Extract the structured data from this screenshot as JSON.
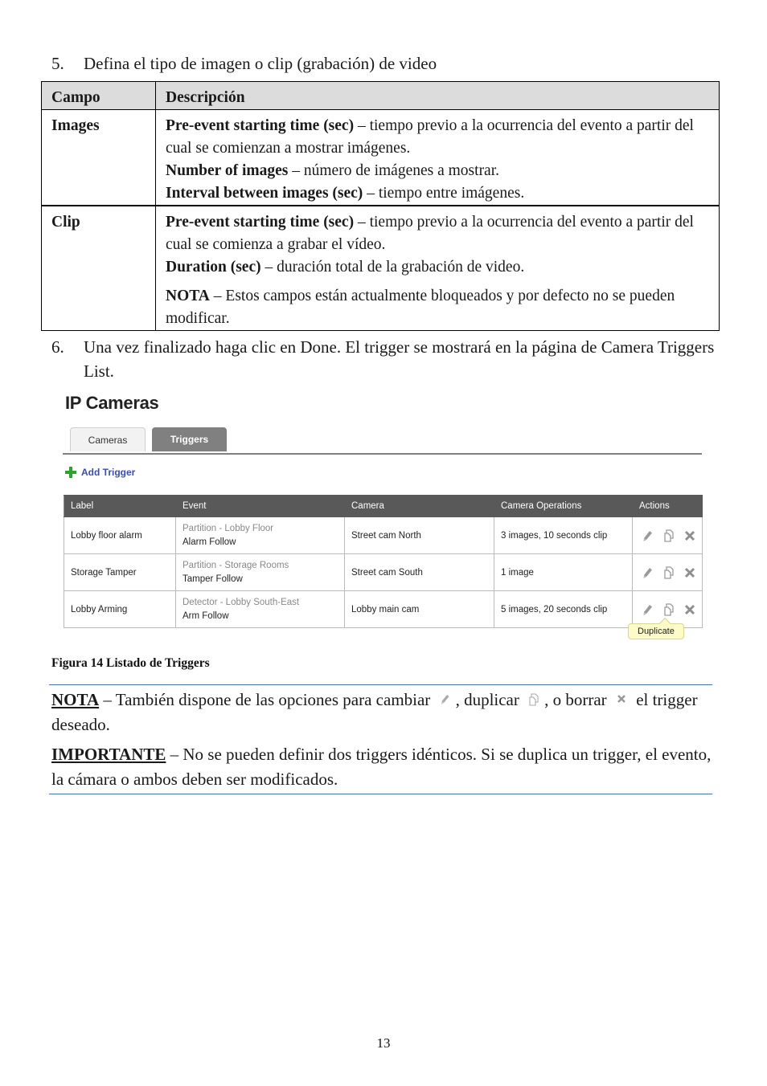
{
  "step5": {
    "number": "5.",
    "text": "Defina el tipo de imagen o clip (grabación) de video"
  },
  "fields_table": {
    "headers": [
      "Campo",
      "Descripción"
    ],
    "rows": [
      {
        "campo": "Images",
        "lines": [
          {
            "term": "Pre-event starting time (sec)",
            "desc": " – tiempo previo a la ocurrencia del evento a partir del cual se comienzan a mostrar imágenes."
          },
          {
            "term": "Number of images",
            "desc": " – número de imágenes a mostrar."
          },
          {
            "term": "Interval between images (sec)",
            "desc": " – tiempo entre imágenes."
          }
        ]
      },
      {
        "campo": "Clip",
        "lines": [
          {
            "term": "Pre-event starting time (sec)",
            "desc": " – tiempo previo a la ocurrencia del evento a partir del cual se comienza a grabar el vídeo."
          },
          {
            "term": "Duration (sec)",
            "desc": " – duración total de la grabación de video."
          },
          {
            "term": "NOTA",
            "desc": " – Estos campos están actualmente bloqueados y por defecto no se pueden modificar."
          }
        ]
      }
    ]
  },
  "step6": {
    "number": "6.",
    "text": "Una vez finalizado haga clic en Done. El trigger se mostrará en la página de Camera Triggers List."
  },
  "screenshot": {
    "title": "IP Cameras",
    "tabs": [
      {
        "label": "Cameras",
        "active": false
      },
      {
        "label": "Triggers",
        "active": true
      }
    ],
    "add_trigger_label": "Add Trigger",
    "table": {
      "headers": [
        "Label",
        "Event",
        "Camera",
        "Camera Operations",
        "Actions"
      ],
      "rows": [
        {
          "label": "Lobby floor alarm",
          "event_type": "Partition - Lobby Floor",
          "event_name": "Alarm Follow",
          "camera": "Street cam North",
          "operations": "3 images, 10 seconds clip"
        },
        {
          "label": "Storage Tamper",
          "event_type": "Partition - Storage Rooms",
          "event_name": "Tamper Follow",
          "camera": "Street cam South",
          "operations": "1 image"
        },
        {
          "label": "Lobby Arming",
          "event_type": "Detector - Lobby South-East",
          "event_name": "Arm Follow",
          "camera": "Lobby main cam",
          "operations": "5 images, 20 seconds clip"
        }
      ],
      "action_icons": [
        "pencil-icon",
        "duplicate-icon",
        "close-icon"
      ]
    },
    "tooltip": "Duplicate"
  },
  "caption": "Figura 14 Listado de Triggers",
  "note": {
    "lead": "NOTA",
    "part1": " – También dispone de las opciones para cambiar ",
    "part2": ", duplicar ",
    "part3": ",  o borrar ",
    "part4": " el trigger deseado."
  },
  "important": {
    "lead": "IMPORTANTE",
    "text": " – No se pueden definir dos triggers idénticos. Si se duplica un trigger, el evento, la cámara o ambos deben ser modificados."
  },
  "page_number": "13",
  "colors": {
    "accent_rule": "#4a72b0",
    "header_bg": "#595959",
    "active_tab": "#808080",
    "link": "#3a4fa8",
    "add_icon": "#2fa32f",
    "tooltip_bg": "#fdfbc8"
  }
}
